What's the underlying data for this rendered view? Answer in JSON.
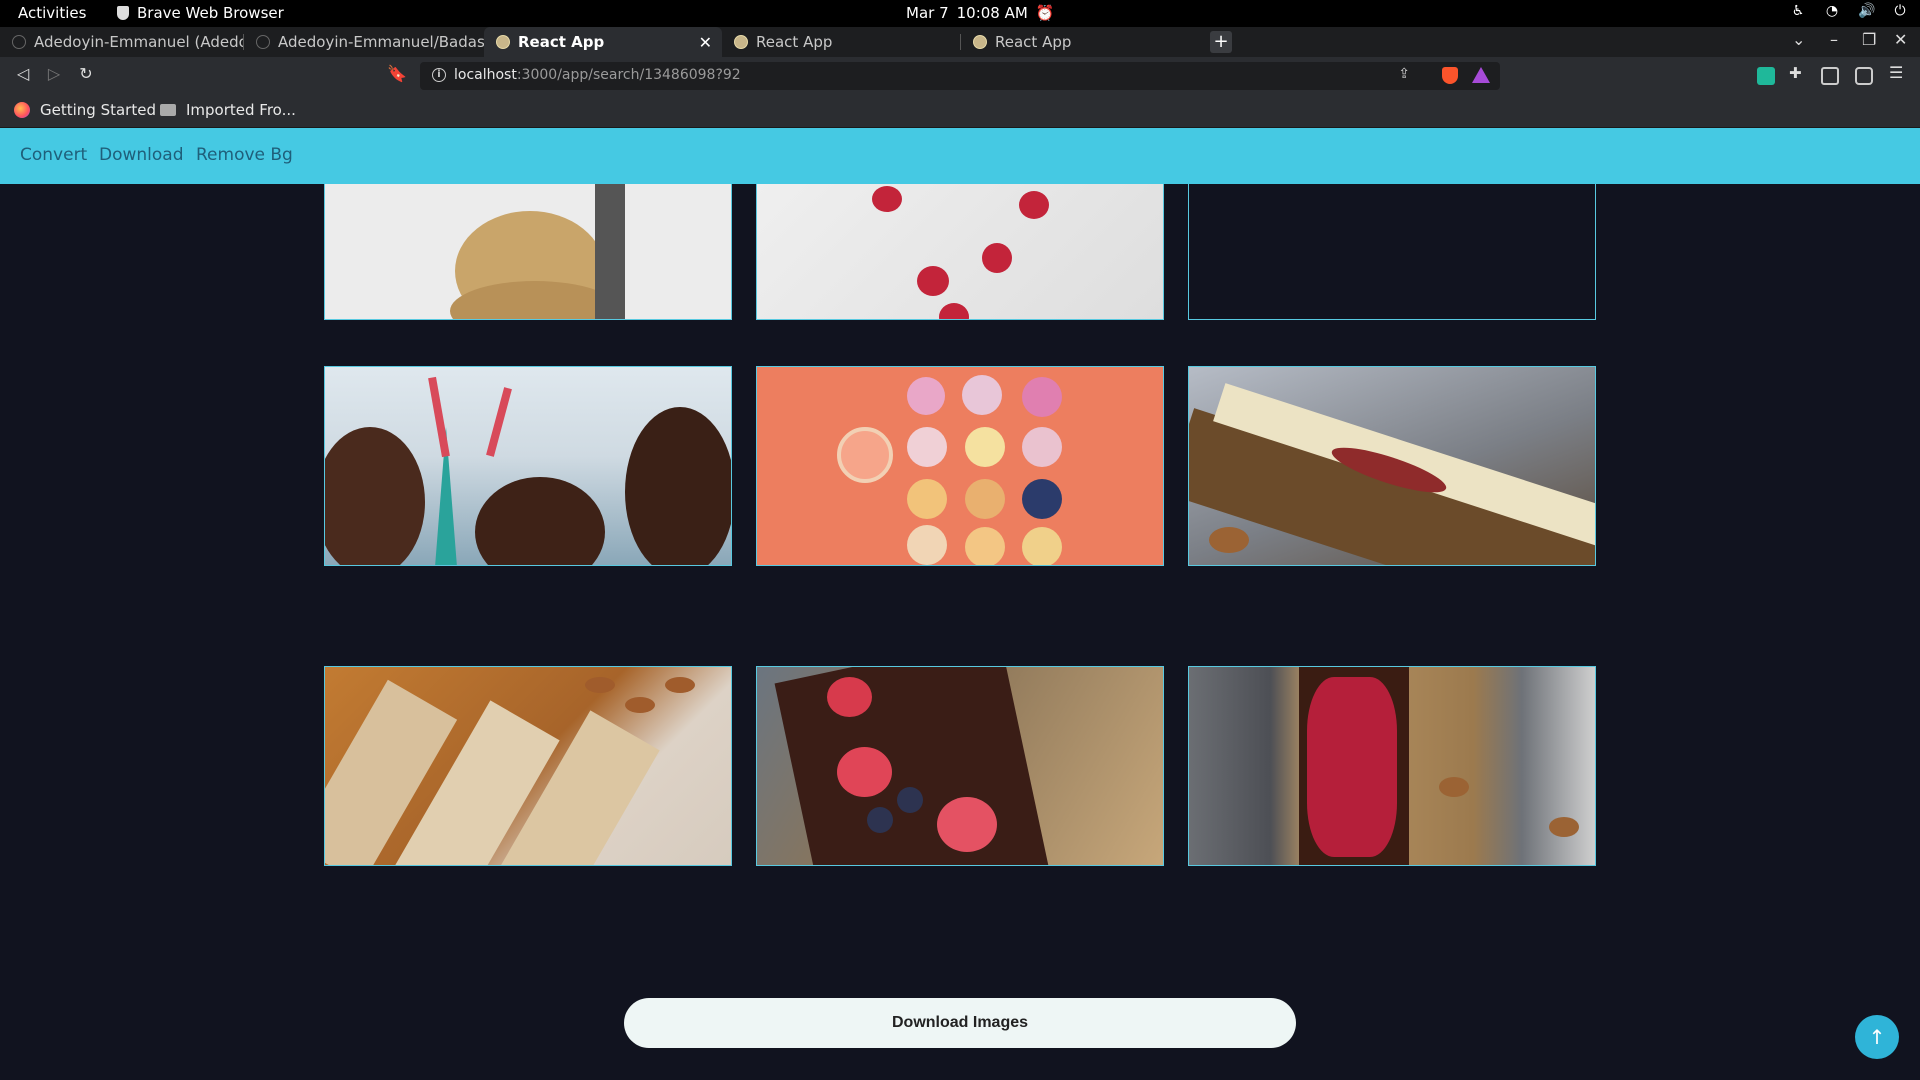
{
  "system_bar": {
    "activities": "Activities",
    "app_name": "Brave Web Browser",
    "date": "Mar 7",
    "time": "10:08 AM"
  },
  "tabs": [
    {
      "title": "Adedoyin-Emmanuel (Adedoy",
      "active": false
    },
    {
      "title": "Adedoyin-Emmanuel/Badass",
      "active": false
    },
    {
      "title": "React App",
      "active": true
    },
    {
      "title": "React App",
      "active": false
    },
    {
      "title": "React App",
      "active": false
    }
  ],
  "address_bar": {
    "host": "localhost",
    "path": ":3000/app/search/13486098?92"
  },
  "bookmarks": [
    {
      "label": "Getting Started",
      "icon": "firefox-icon"
    },
    {
      "label": "Imported Fro...",
      "icon": "folder-icon"
    }
  ],
  "nav": {
    "items": [
      "Convert",
      "Download",
      "Remove Bg"
    ]
  },
  "images": [
    {
      "name": "cookies-image"
    },
    {
      "name": "strawberry-cupcakes-image"
    },
    {
      "name": "empty-image-slot"
    },
    {
      "name": "christmas-chocolates-image"
    },
    {
      "name": "fruit-donuts-image"
    },
    {
      "name": "white-chocolate-bar-image"
    },
    {
      "name": "almond-nougat-image"
    },
    {
      "name": "berry-chocolate-bar-image"
    },
    {
      "name": "cranberry-chocolate-bar-image"
    }
  ],
  "download_button": "Download Images",
  "colors": {
    "nav_bg": "#45c9e3",
    "page_bg": "#11131f",
    "card_border": "#58c9e0",
    "scroll_top_bg": "#2fb4d8"
  }
}
